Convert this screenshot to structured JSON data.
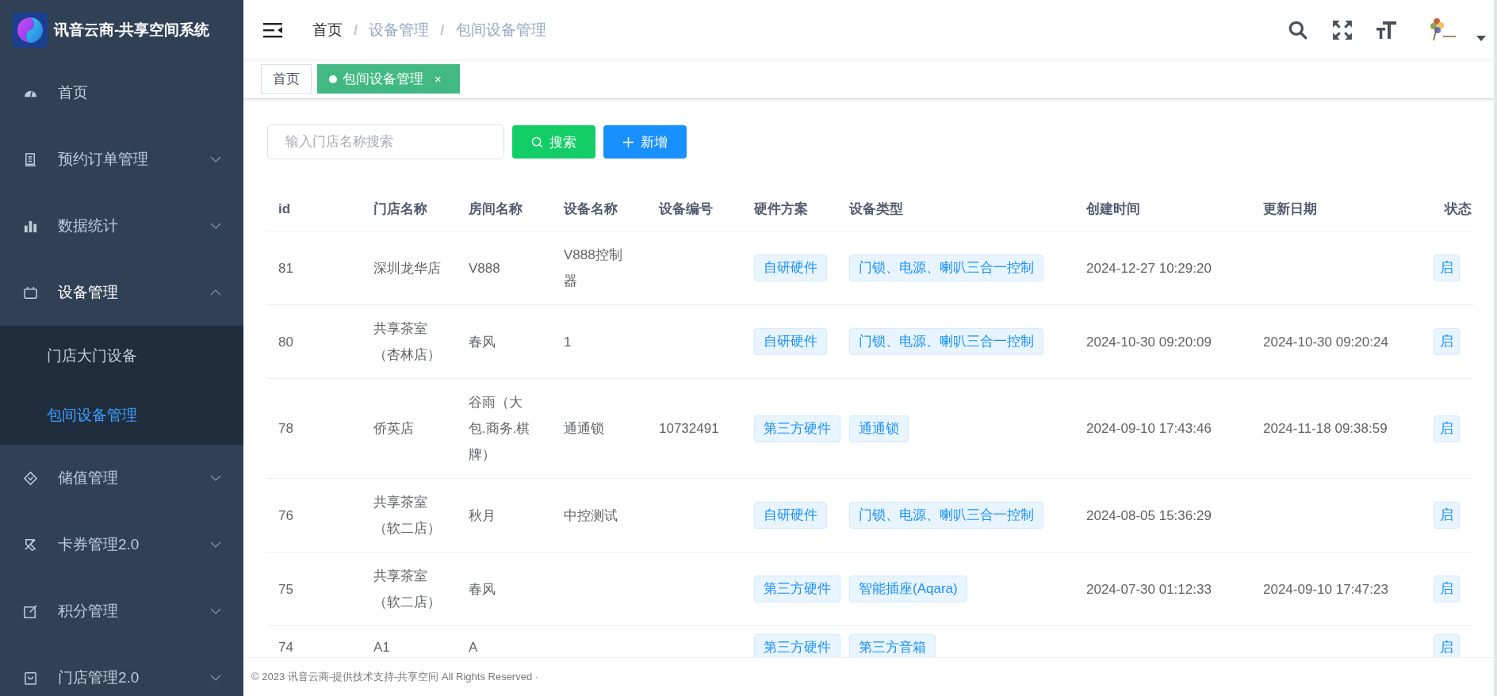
{
  "sidebar": {
    "title": "讯音云商-共享空间系统",
    "items": [
      {
        "label": "首页",
        "kind": "link"
      },
      {
        "label": "预约订单管理",
        "kind": "submenu",
        "expanded": false
      },
      {
        "label": "数据统计",
        "kind": "submenu",
        "expanded": false
      },
      {
        "label": "设备管理",
        "kind": "submenu",
        "expanded": true,
        "children": [
          {
            "label": "门店大门设备",
            "selected": false
          },
          {
            "label": "包间设备管理",
            "selected": true
          }
        ]
      },
      {
        "label": "储值管理",
        "kind": "submenu",
        "expanded": false
      },
      {
        "label": "卡券管理2.0",
        "kind": "submenu",
        "expanded": false
      },
      {
        "label": "积分管理",
        "kind": "submenu",
        "expanded": false
      },
      {
        "label": "门店管理2.0",
        "kind": "submenu",
        "expanded": false
      }
    ]
  },
  "breadcrumb": [
    {
      "label": "首页"
    },
    {
      "separator": "/",
      "label": "设备管理"
    },
    {
      "separator": "/",
      "label": "包间设备管理"
    }
  ],
  "tags": [
    {
      "label": "首页",
      "selected": false
    },
    {
      "label": "包间设备管理",
      "selected": true,
      "close": "×"
    }
  ],
  "search": {
    "placeholder": "输入门店名称搜索"
  },
  "buttons": [
    {
      "label": "搜索",
      "kind": "search"
    },
    {
      "label": "新增",
      "kind": "add"
    }
  ],
  "table": {
    "columns": [
      "id",
      "门店名称",
      "房间名称",
      "设备名称",
      "设备编号",
      "硬件方案",
      "设备类型",
      "创建时间",
      "更新日期",
      "状态"
    ],
    "rows": [
      {
        "id": "81",
        "store": "深圳龙华店",
        "room": "V888",
        "device_name": "V888控制器",
        "hardware": "自研硬件",
        "device_type": "门锁、电源、喇叭三合一控制",
        "created": "2024-12-27 10:29:20",
        "status": "启"
      },
      {
        "id": "80",
        "store": "共享茶室（杏林店）",
        "room": "春风",
        "device_name": "1",
        "hardware": "自研硬件",
        "device_type": "门锁、电源、喇叭三合一控制",
        "created": "2024-10-30 09:20:09",
        "updated": "2024-10-30 09:20:24",
        "status": "启"
      },
      {
        "id": "78",
        "store": "侨英店",
        "room": "谷雨（大包.商务.棋牌）",
        "device_name": "通通锁",
        "device_no": "10732491",
        "hardware": "第三方硬件",
        "device_type": "通通锁",
        "created": "2024-09-10 17:43:46",
        "updated": "2024-11-18 09:38:59",
        "status": "启"
      },
      {
        "id": "76",
        "store": "共享茶室（软二店）",
        "room": "秋月",
        "device_name": "中控测试",
        "hardware": "自研硬件",
        "device_type": "门锁、电源、喇叭三合一控制",
        "created": "2024-08-05 15:36:29",
        "status": "启"
      },
      {
        "id": "75",
        "store": "共享茶室（软二店）",
        "room": "春风",
        "hardware": "第三方硬件",
        "device_type": "智能插座(Aqara)",
        "created": "2024-07-30 01:12:33",
        "updated": "2024-09-10 17:47:23",
        "status": "启"
      },
      {
        "id": "74",
        "store": "A1",
        "room": "A",
        "hardware": "第三方硬件",
        "device_type": "第三方音箱",
        "status": "启"
      }
    ]
  },
  "footer": "© 2023 讯音云商-提供技术支持-共享空间 All Rights Reserved ·"
}
